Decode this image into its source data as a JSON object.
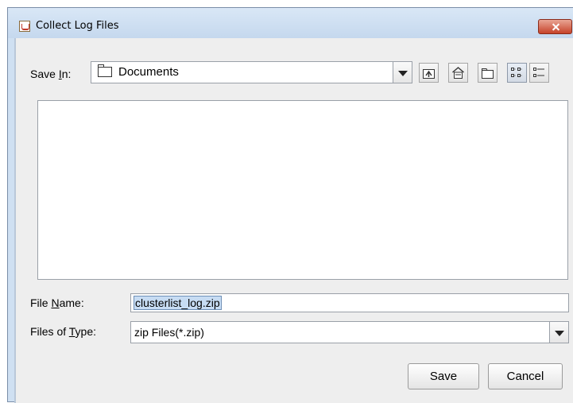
{
  "window": {
    "title": "Collect Log Files"
  },
  "save_in": {
    "label_pre": "Save ",
    "label_mnemonic": "I",
    "label_post": "n:",
    "value": "Documents"
  },
  "toolbar": {
    "icons": [
      "up-one-level-icon",
      "home-icon",
      "new-folder-icon",
      "list-view-icon",
      "details-view-icon"
    ]
  },
  "file_name": {
    "label_pre": "File ",
    "label_mnemonic": "N",
    "label_post": "ame:",
    "value": "clusterlist_log.zip"
  },
  "file_type": {
    "label_pre": "Files of ",
    "label_mnemonic": "T",
    "label_post": "ype:",
    "value": "zip Files(*.zip)"
  },
  "buttons": {
    "save": "Save",
    "cancel": "Cancel"
  }
}
